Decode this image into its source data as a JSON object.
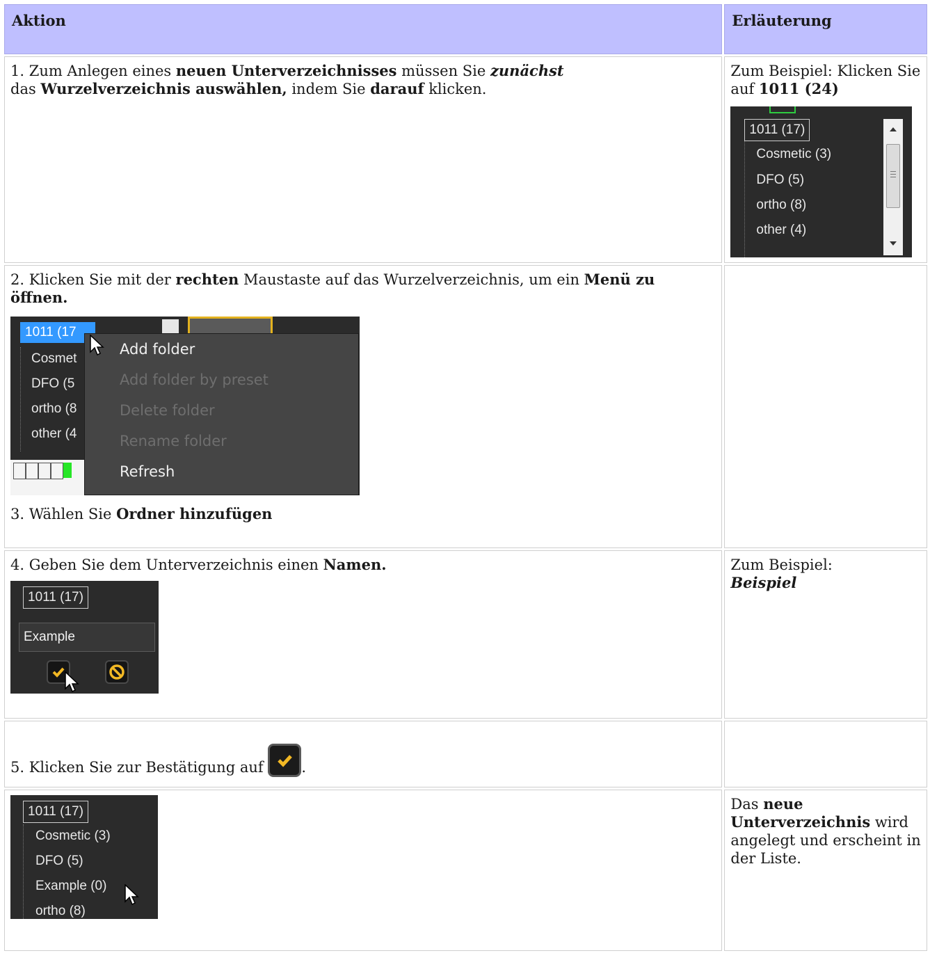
{
  "table": {
    "headers": {
      "action": "Aktion",
      "note": "Erläuterung"
    }
  },
  "row1": {
    "n": "1.",
    "t1": " Zum Anlegen eines ",
    "b1": "neuen Unterverzeichnisses",
    "t2": " müssen Sie ",
    "bi1": "zunächst",
    "t3": "das ",
    "b2": "Wurzelverzeichnis auswählen,",
    "t4": " indem Sie ",
    "b3": "darauf",
    "t5": " klicken.",
    "note_text": "Zum Beispiel: Klicken Sie auf ",
    "note_bold": "1011 (24)",
    "tree": {
      "root": "1011 (17)",
      "items": [
        "Cosmetic (3)",
        "DFO (5)",
        "ortho (8)",
        "other (4)"
      ]
    }
  },
  "row2": {
    "n": "2.",
    "t1": " Klicken Sie mit der ",
    "b1": "rechten",
    "t2": " Maustaste auf das Wurzelverzeichnis, um ein ",
    "b2": "Menü zu öffnen.",
    "screenshot": {
      "root": "1011 (17",
      "items": [
        "Cosmet",
        "DFO (5",
        "ortho (8",
        "other (4"
      ],
      "menu": [
        {
          "label": "Add folder",
          "enabled": true
        },
        {
          "label": "Add folder by preset",
          "enabled": false
        },
        {
          "label": "Delete folder",
          "enabled": false
        },
        {
          "label": "Rename folder",
          "enabled": false
        },
        {
          "label": "Refresh",
          "enabled": true
        }
      ]
    },
    "step3_n": "3.",
    "step3_t": " Wählen Sie ",
    "step3_b": "Ordner hinzufügen"
  },
  "row4": {
    "n": "4.",
    "t1": " Geben Sie dem Unterverzeichnis einen ",
    "b1": "Namen.",
    "root": "1011 (17)",
    "input_value": "Example",
    "note_text": "Zum Beispiel:",
    "note_bi": "Beispiel"
  },
  "row5": {
    "n": "5.",
    "t1": " Klicken Sie zur Bestätigung auf ",
    "t2": "."
  },
  "row6": {
    "tree": {
      "root": "1011 (17)",
      "items": [
        "Cosmetic (3)",
        "DFO (5)",
        "Example (0)",
        "ortho (8)"
      ]
    },
    "note_t1": "Das ",
    "note_b1": "neue Unterverzeichnis",
    "note_t2": " wird angelegt und erscheint in der Liste."
  },
  "colors": {
    "header_bg": "#bfbfff",
    "accent": "#3399ff",
    "checkmark": "#f2b824"
  },
  "icons": [
    "cursor-icon",
    "checkmark-icon",
    "cancel-icon",
    "scroll-up-icon",
    "scroll-down-icon"
  ]
}
